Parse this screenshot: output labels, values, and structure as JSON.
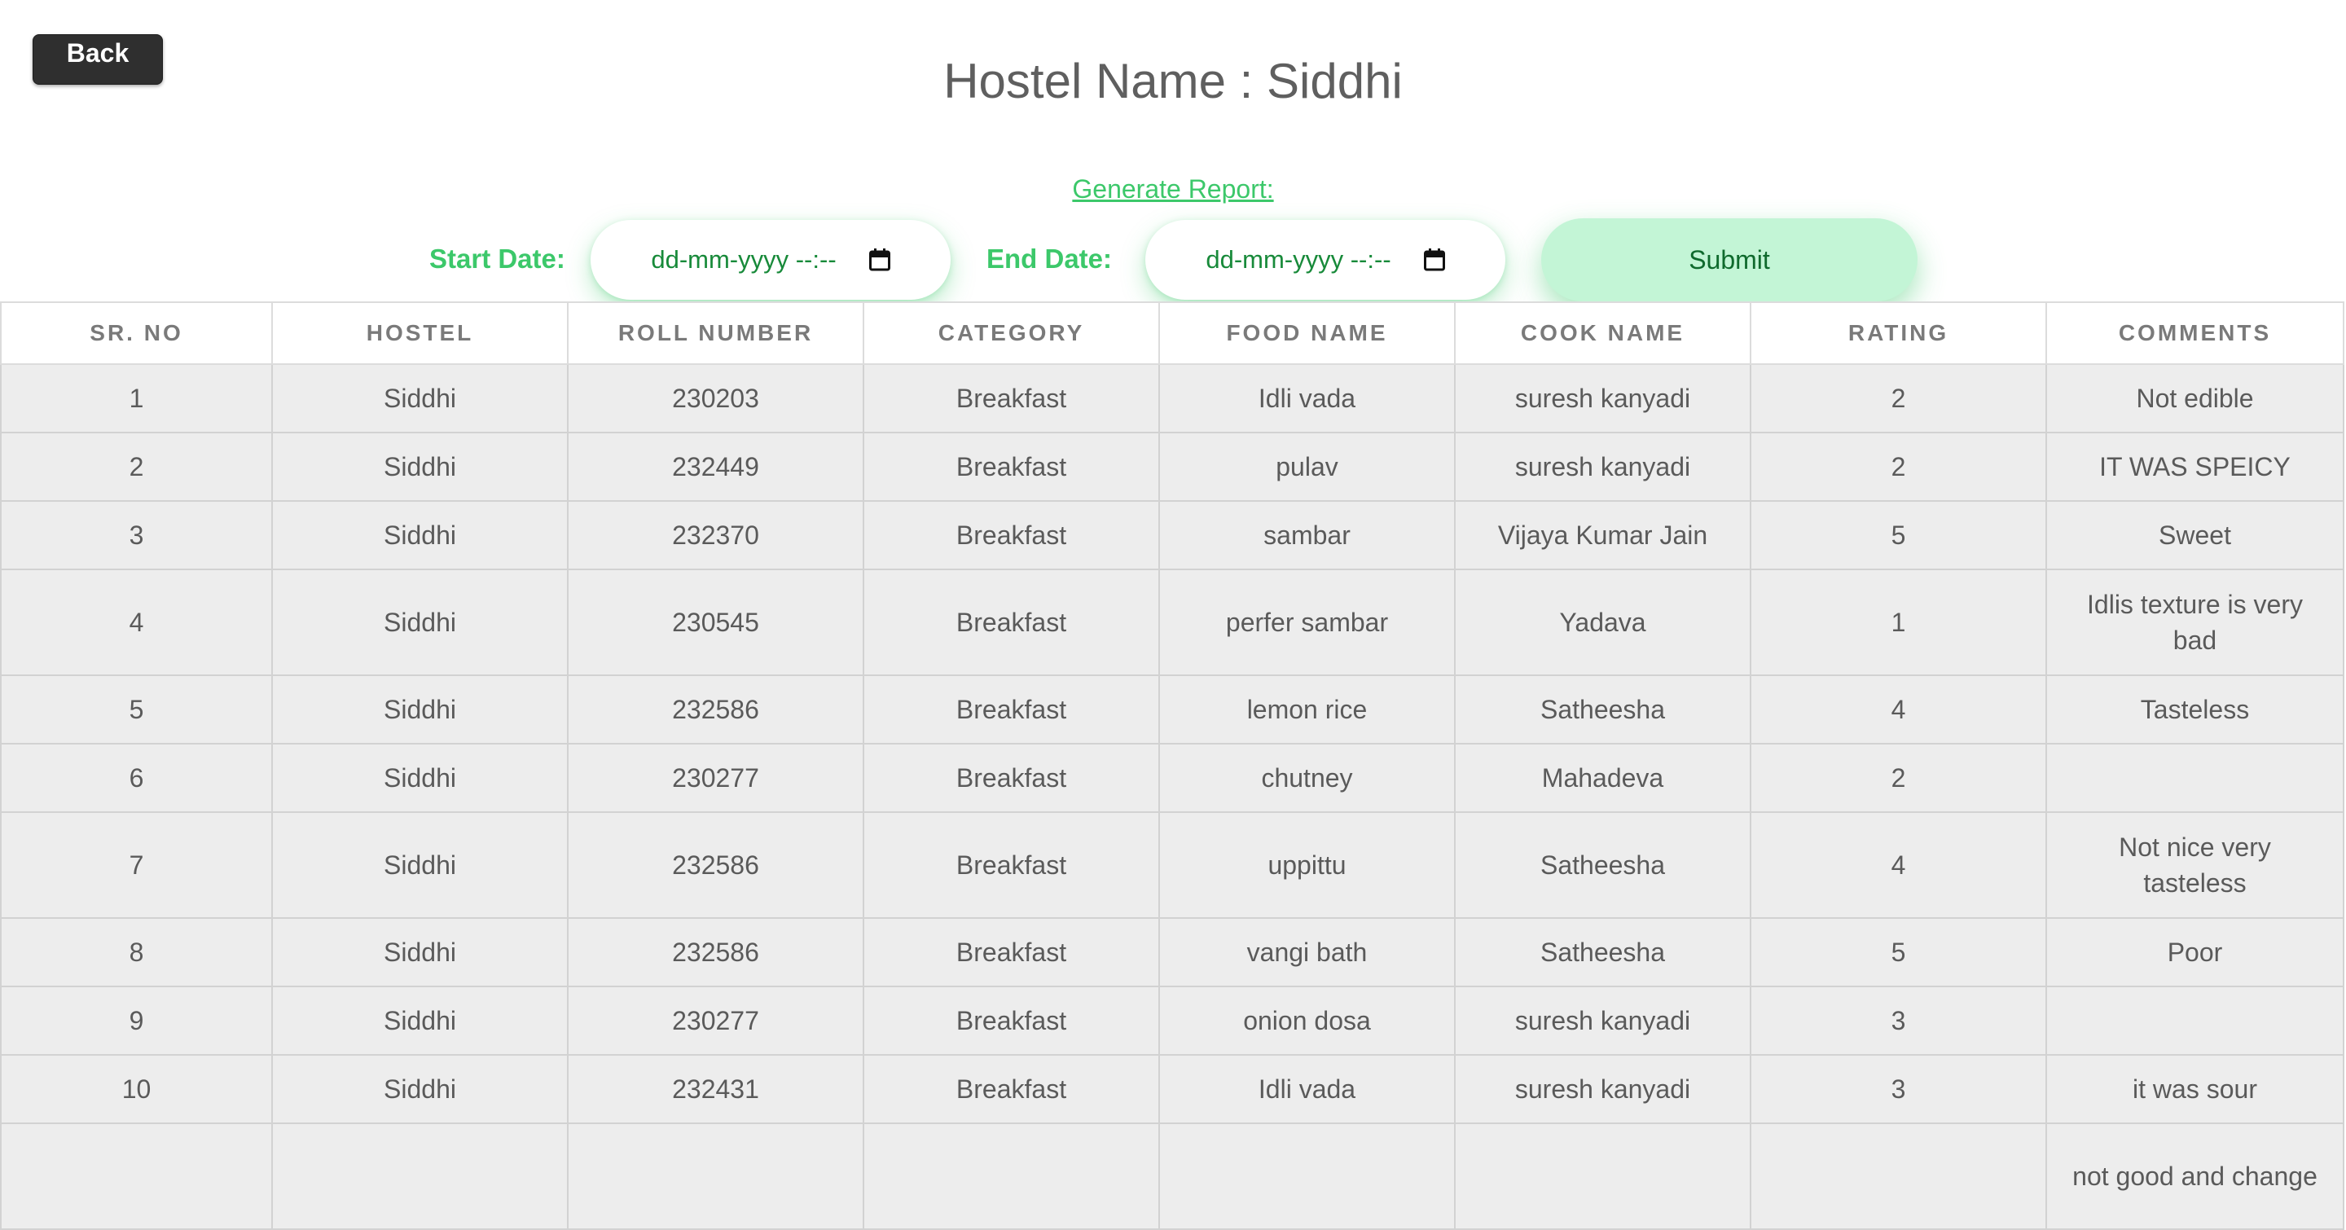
{
  "back_label": "Back",
  "page_title": "Hostel Name : Siddhi",
  "report": {
    "link_label": "Generate Report:",
    "start_label": "Start Date:",
    "start_placeholder": "dd-mm-yyyy --:--",
    "end_label": "End Date:",
    "end_placeholder": "dd-mm-yyyy --:--",
    "submit_label": "Submit",
    "accent_color": "#3cc86a"
  },
  "table": {
    "columns": [
      "SR. NO",
      "HOSTEL",
      "ROLL NUMBER",
      "CATEGORY",
      "FOOD NAME",
      "COOK NAME",
      "RATING",
      "COMMENTS"
    ],
    "rows": [
      [
        "1",
        "Siddhi",
        "230203",
        "Breakfast",
        "Idli vada",
        "suresh kanyadi",
        "2",
        "Not edible"
      ],
      [
        "2",
        "Siddhi",
        "232449",
        "Breakfast",
        "pulav",
        "suresh kanyadi",
        "2",
        "IT WAS SPEICY"
      ],
      [
        "3",
        "Siddhi",
        "232370",
        "Breakfast",
        "sambar",
        "Vijaya Kumar Jain",
        "5",
        "Sweet"
      ],
      [
        "4",
        "Siddhi",
        "230545",
        "Breakfast",
        "perfer sambar",
        "Yadava",
        "1",
        "Idlis texture is very bad"
      ],
      [
        "5",
        "Siddhi",
        "232586",
        "Breakfast",
        "lemon rice",
        "Satheesha",
        "4",
        "Tasteless"
      ],
      [
        "6",
        "Siddhi",
        "230277",
        "Breakfast",
        "chutney",
        "Mahadeva",
        "2",
        ""
      ],
      [
        "7",
        "Siddhi",
        "232586",
        "Breakfast",
        "uppittu",
        "Satheesha",
        "4",
        "Not nice very tasteless"
      ],
      [
        "8",
        "Siddhi",
        "232586",
        "Breakfast",
        "vangi bath",
        "Satheesha",
        "5",
        "Poor"
      ],
      [
        "9",
        "Siddhi",
        "230277",
        "Breakfast",
        "onion dosa",
        "suresh kanyadi",
        "3",
        ""
      ],
      [
        "10",
        "Siddhi",
        "232431",
        "Breakfast",
        "Idli vada",
        "suresh kanyadi",
        "3",
        "it was sour"
      ],
      [
        "",
        "",
        "",
        "",
        "",
        "",
        "",
        "not good and change"
      ]
    ]
  }
}
